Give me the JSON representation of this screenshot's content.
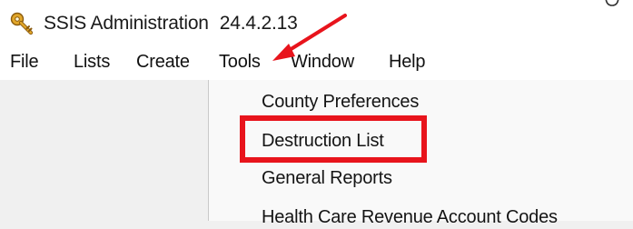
{
  "window": {
    "title": "SSIS Administration",
    "version": "24.4.2.13",
    "app_icon": "key-icon"
  },
  "menubar": {
    "items": [
      {
        "label": "File"
      },
      {
        "label": "Lists"
      },
      {
        "label": "Create"
      },
      {
        "label": "Tools"
      },
      {
        "label": "Window"
      },
      {
        "label": "Help"
      }
    ]
  },
  "tools_menu": {
    "items": [
      {
        "label": "County Preferences"
      },
      {
        "label": "Destruction List"
      },
      {
        "label": "General Reports"
      },
      {
        "label": "Health Care Revenue Account Codes"
      }
    ]
  },
  "annotations": {
    "color": "#e8141c",
    "highlighted_item": "Destruction List",
    "arrow_points_to": "Tools"
  }
}
